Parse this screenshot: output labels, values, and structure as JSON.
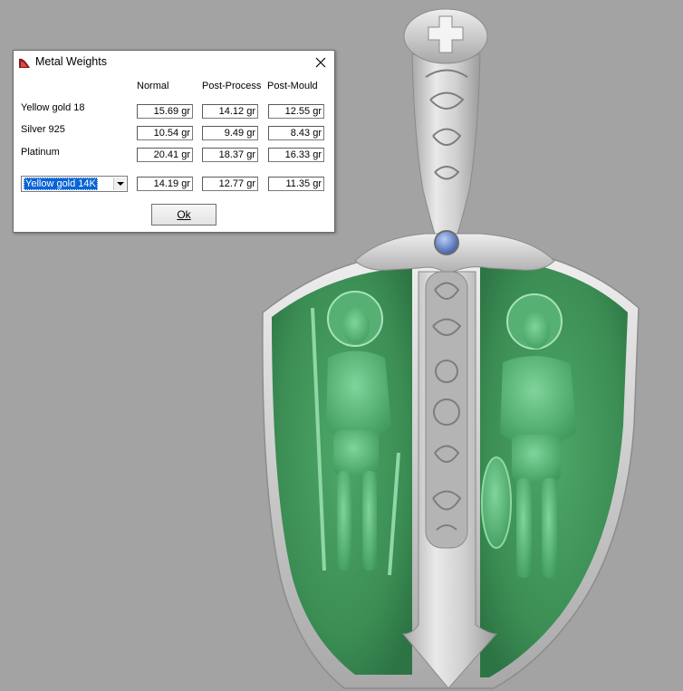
{
  "dialog": {
    "title": "Metal Weights",
    "close_icon": "close-icon",
    "columns": [
      "Normal",
      "Post-Process",
      "Post-Mould"
    ],
    "rows": [
      {
        "label": "Yellow gold 18",
        "values": [
          "15.69 gr",
          "14.12 gr",
          "12.55 gr"
        ]
      },
      {
        "label": "Silver 925",
        "values": [
          "10.54 gr",
          "9.49 gr",
          "8.43 gr"
        ]
      },
      {
        "label": "Platinum",
        "values": [
          "20.41 gr",
          "18.37 gr",
          "16.33 gr"
        ]
      }
    ],
    "custom_row": {
      "selected_metal": "Yellow gold 14K",
      "values": [
        "14.19 gr",
        "12.77 gr",
        "11.35 gr"
      ]
    },
    "ok_label": "Ok"
  },
  "colors": {
    "background": "#a3a3a3",
    "green_field": "#3d8f55",
    "silver": "#c9c9c9",
    "gem": "#4a6fb5",
    "selection": "#0a64d6"
  }
}
